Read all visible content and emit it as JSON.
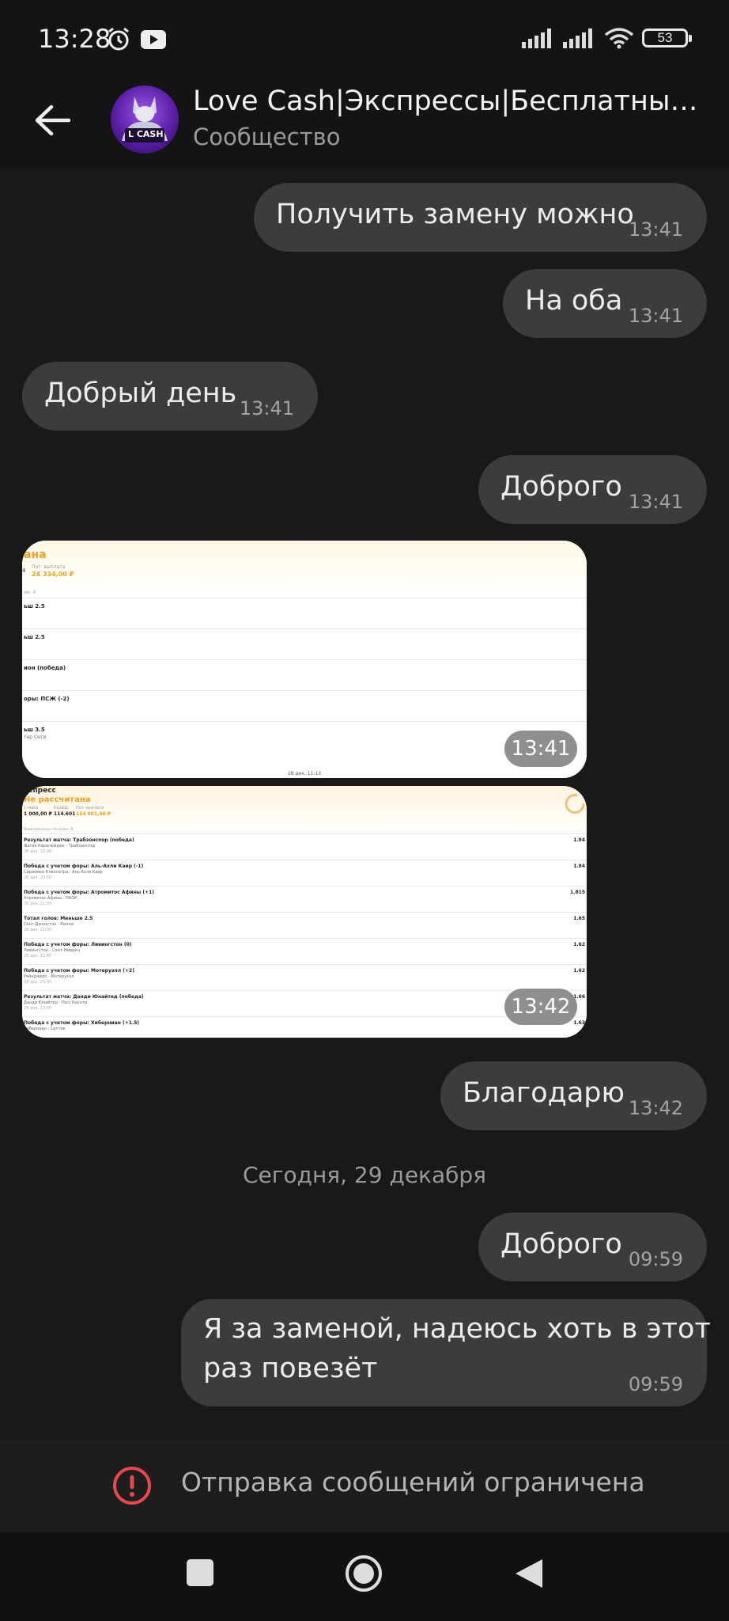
{
  "status": {
    "time": "13:28",
    "battery": "53"
  },
  "header": {
    "title": "Love Cash|Экспрессы|Бесплатные...",
    "subtitle": "Сообщество",
    "avatar_text": "L CASH"
  },
  "messages": [
    {
      "text": "Получить замену можно",
      "time": "13:41"
    },
    {
      "text": "На оба",
      "time": "13:41"
    },
    {
      "text": "Добрый день",
      "time": "13:41"
    },
    {
      "text": "Доброго",
      "time": "13:41"
    },
    {
      "text": "Благодарю",
      "time": "13:42"
    },
    {
      "text": "Доброго",
      "time": "09:59"
    },
    {
      "line1": "Я за заменой, надеюсь хоть в этот",
      "line2": "раз повезёт",
      "time": "09:59"
    }
  ],
  "images": [
    {
      "time": "13:41",
      "title": "ана",
      "left_stub": "4",
      "payout_label": "Пот. выплата",
      "payout": "24 334,00 ₽",
      "section": "ие: 4",
      "rows": [
        "ьш 2.5",
        "ьш 2.5",
        "ион (победа)",
        "оры: ПСЖ (-2)",
        "ьш 3.5"
      ],
      "row5_sub": "тер Сити",
      "footer": "28 дек, 11:13"
    },
    {
      "time": "13:42",
      "title": "кспресс",
      "status": "Не рассчитана",
      "stake_label": "Ставка",
      "stake": "1 000,00 ₽",
      "coef_label": "Коэфф.",
      "coef": "114.601",
      "payout_label": "Пот. выплата",
      "payout": "114 601,40 ₽",
      "section": "Выигрышные исходы: 8",
      "rows": [
        {
          "title": "Результат матча: Трабзонспор (победа)",
          "sub": "Фатих Карагюмрюк - Трабзонспор",
          "date": "28 дек, 20:00",
          "odd": "1.84"
        },
        {
          "title": "Победа с учетом форы: Аль-Ахли Каир (-1)",
          "sub": "Сирамика Клеопатра - Аль-Ахли Каир",
          "date": "28 дек, 20:00",
          "odd": "1.84"
        },
        {
          "title": "Победа с учетом форы: Атромитос Афины (+1)",
          "sub": "Атромитос Афины - ПАОК",
          "date": "28 дек, 21:00",
          "odd": "1.815"
        },
        {
          "title": "Тотал голов: Меньше 2.5",
          "sub": "Сент-Джонстон - Килли",
          "date": "28 дек, 22:00",
          "odd": "1.65"
        },
        {
          "title": "Победа с учетом форы: Ливингстон (0)",
          "sub": "Ливингстон - Сент-Миррен",
          "date": "28 дек, 22:45",
          "odd": "1.62"
        },
        {
          "title": "Победа с учетом форы: Мотеруэлл (+2)",
          "sub": "Рейнджерс - Мотеруэлл",
          "date": "28 дек, 23:00",
          "odd": "1.62"
        },
        {
          "title": "Результат матча: Данди Юнайтед (победа)",
          "sub": "Данди Юнайтед - Росс Каунти",
          "date": "28 дек, 23:00",
          "odd": "1.66"
        },
        {
          "title": "Победа с учетом форы: Хиберниан (+1.5)",
          "sub": "Хиберниан - Селтик",
          "date": "",
          "odd": "1.63"
        }
      ]
    }
  ],
  "date_separator": "Сегодня, 29 декабря",
  "restricted": "Отправка сообщений ограничена",
  "colors": {
    "background": "#191919",
    "bubble": "#3c3c3c",
    "warning": "#e5484d",
    "accent_orange": "#f0a020"
  }
}
